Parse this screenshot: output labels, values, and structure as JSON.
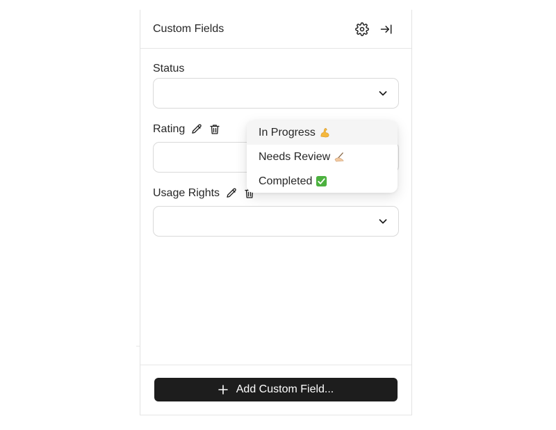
{
  "panel": {
    "title": "Custom Fields",
    "header_icons": [
      "gear-icon",
      "collapse-panel-icon"
    ]
  },
  "fields": [
    {
      "label": "Status",
      "value": "",
      "editable_label": false
    },
    {
      "label": "Rating",
      "value": "",
      "editable_label": true
    },
    {
      "label": "Usage Rights",
      "value": "",
      "editable_label": true
    }
  ],
  "dropdown": {
    "options": [
      {
        "label": "In Progress",
        "emoji": "flexed-biceps"
      },
      {
        "label": "Needs Review",
        "emoji": "writing-hand"
      },
      {
        "label": "Completed",
        "emoji": "check-mark-button"
      }
    ],
    "highlighted_index": 0
  },
  "footer": {
    "add_button_label": "Add Custom Field..."
  },
  "colors": {
    "button_bg": "#1d1d1d",
    "border": "#d9d9d9",
    "check_green": "#4cb13f",
    "biceps_yellow": "#f5b83d"
  }
}
